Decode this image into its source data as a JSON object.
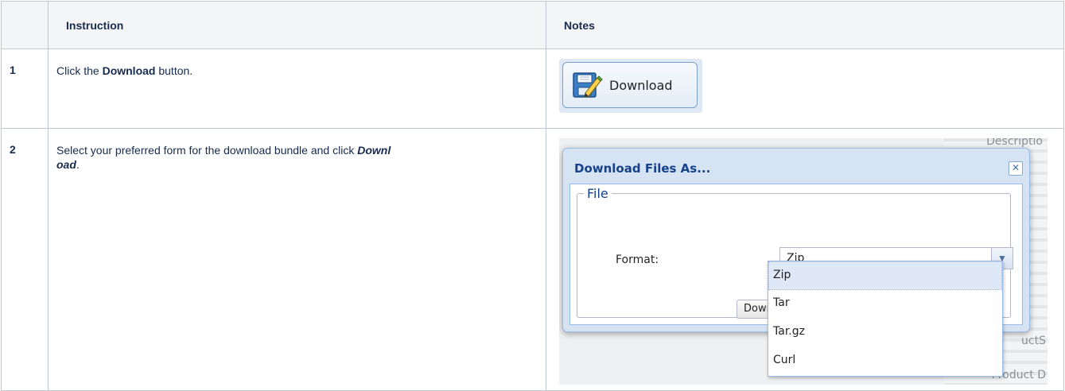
{
  "table": {
    "headers": {
      "number": "",
      "instruction": "Instruction",
      "notes": "Notes"
    },
    "rows": [
      {
        "number": "1",
        "instruction": {
          "before": "Click the ",
          "bold": "Download",
          "after": " button."
        }
      },
      {
        "number": "2",
        "instruction": {
          "before": "Select your preferred form for the download bundle and click ",
          "bold_italic_a": "Downl",
          "bold_italic_b": "oad",
          "after": "."
        }
      }
    ]
  },
  "screenshot1": {
    "button_label": "Download",
    "icon": "save-edit-icon"
  },
  "screenshot2": {
    "dialog_title": "Download Files As...",
    "fieldset_legend": "File",
    "format_label": "Format:",
    "format_value": "Zip",
    "download_button_partial": "Dowr",
    "options": [
      "Zip",
      "Tar",
      "Tar.gz",
      "Curl"
    ],
    "selected_option": "Zip",
    "bg_fragments": {
      "top": "Descriptio",
      "middle": "uctS",
      "bottom": "Product D"
    }
  },
  "colors": {
    "header_bg": "#f4f5f7",
    "border": "#c1c7d0",
    "dialog_title": "#15428b",
    "selected_option_bg": "#dfe8f6"
  }
}
